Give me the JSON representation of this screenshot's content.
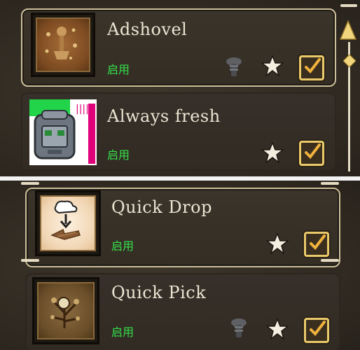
{
  "mods": [
    {
      "title": "Adshovel",
      "status": "启用",
      "thumb_icon": "shovel-icon"
    },
    {
      "title": "Always fresh",
      "status": "启用",
      "thumb_icon": "backpack-icon"
    },
    {
      "title": "Quick Drop",
      "status": "启用",
      "thumb_icon": "drop-arrow-icon"
    },
    {
      "title": "Quick Pick",
      "status": "启用",
      "thumb_icon": "berry-bush-icon"
    }
  ],
  "colors": {
    "status": "#35e04a",
    "accent": "#e9c96a",
    "title": "#ece4d2"
  }
}
